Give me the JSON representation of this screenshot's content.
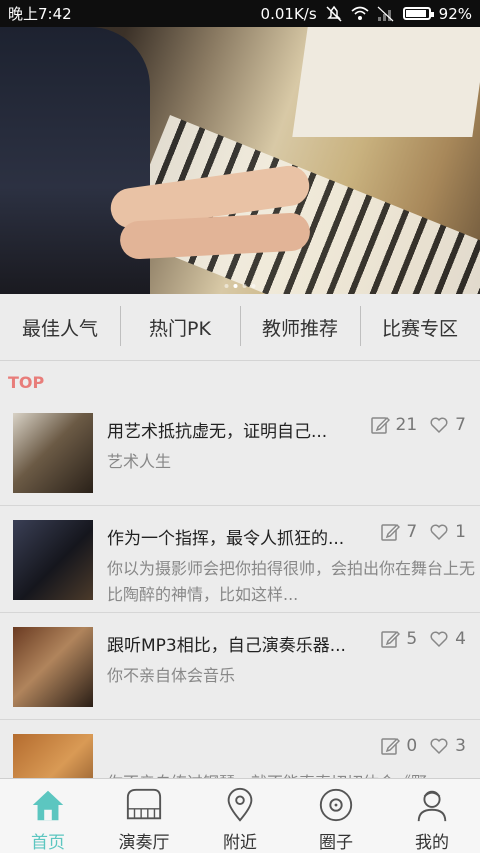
{
  "status_bar": {
    "time": "晚上7:42",
    "net_speed": "0.01K/s",
    "battery": "92%",
    "battery_level": 0.92
  },
  "banner": {
    "dots": 4,
    "active_dot": 1
  },
  "categories": [
    {
      "label": "最佳人气"
    },
    {
      "label": "热门PK"
    },
    {
      "label": "教师推荐"
    },
    {
      "label": "比赛专区"
    }
  ],
  "section_label": "TOP",
  "posts": [
    {
      "title": "用艺术抵抗虚无，证明自己...",
      "desc": "艺术人生",
      "comments": "21",
      "likes": "7"
    },
    {
      "title": "作为一个指挥，最令人抓狂的...",
      "desc": "你以为摄影师会把你拍得很帅，会拍出你在舞台上无比陶醉的神情，比如这样...",
      "comments": "7",
      "likes": "1"
    },
    {
      "title": "跟听MP3相比，自己演奏乐器...",
      "desc": "你不亲自体会音乐",
      "comments": "5",
      "likes": "4"
    },
    {
      "title": "",
      "desc": "你不亲自练过钢琴，就不能真真切切体会《野",
      "comments": "0",
      "likes": "3"
    }
  ],
  "bottom_nav": [
    {
      "label": "首页",
      "icon": "home-icon"
    },
    {
      "label": "演奏厅",
      "icon": "piano-icon"
    },
    {
      "label": "附近",
      "icon": "location-icon"
    },
    {
      "label": "圈子",
      "icon": "disc-icon"
    },
    {
      "label": "我的",
      "icon": "person-icon"
    }
  ],
  "colors": {
    "accent": "#5cc6c0",
    "top_label": "#e87d7a"
  }
}
